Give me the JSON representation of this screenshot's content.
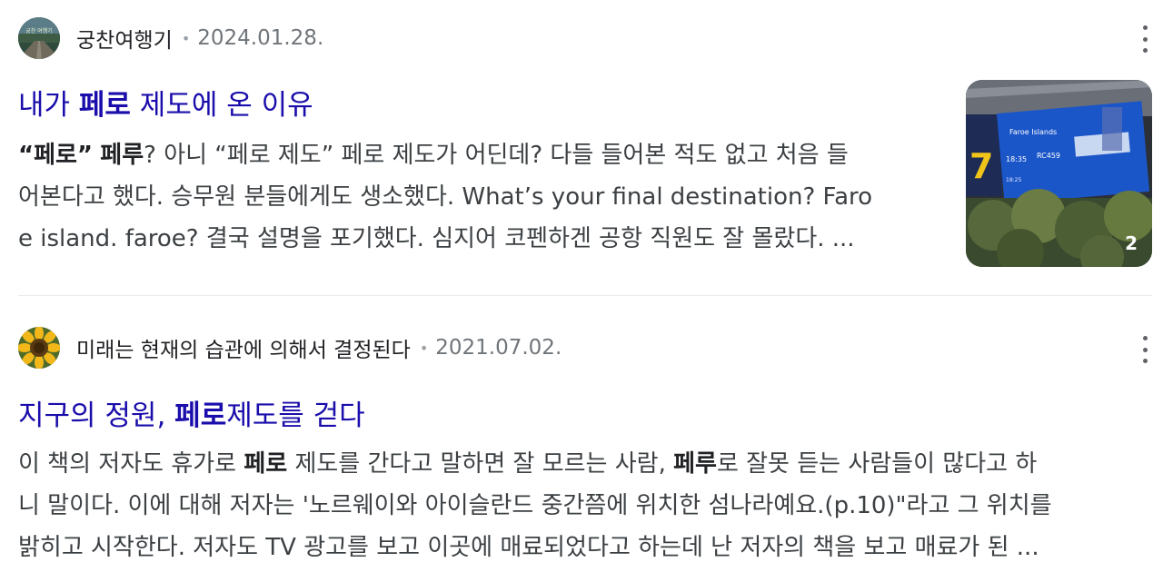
{
  "results": [
    {
      "source": "궁찬여행기",
      "separator": "•",
      "date": "2024.01.28.",
      "avatar_icon": "travel-landscape-avatar",
      "title_pre": "내가 ",
      "title_bold": "페로",
      "title_post": " 제도에 온 이유",
      "snippet": {
        "l1_b1": "“페로”",
        "l1_t1": " ",
        "l1_b2": "페루",
        "l1_t2": "? 아니 “페로 제도” 페로 제도가 어딘데? 다들 들어본 적도 없고 처음 들",
        "l2": "어본다고 했다. 승무원 분들에게도 생소했다. What’s your final destination? Faro",
        "l3": "e island. faroe? 결국 설명을 포기했다. 심지어 코펜하겐 공항 직원도 잘 몰랐다. ..."
      },
      "thumbnail": {
        "image_count": "2",
        "board_header": "Faroe Islands",
        "board_time": "18:35",
        "board_flight": "RC459",
        "board_time2": "18:25",
        "board_gate": "7"
      }
    },
    {
      "source": "미래는 현재의 습관에 의해서 결정된다",
      "separator": "•",
      "date": "2021.07.02.",
      "avatar_icon": "sunflower-avatar",
      "title_pre": "지구의 정원, ",
      "title_bold": "페로",
      "title_post": "제도를 걷다",
      "snippet": {
        "l1_t1": "이 책의 저자도 휴가로 ",
        "l1_b1": "페로",
        "l1_t2": " 제도를 간다고 말하면 잘 모르는 사람, ",
        "l1_b2": "페루",
        "l1_t3": "로 잘못 듣는 사람들이 많다고 하",
        "l2": "니 말이다. 이에 대해 저자는 '노르웨이와 아이슬란드 중간쯤에 위치한 섬나라예요.(p.10)\"라고 그 위치를",
        "l3": "밝히고 시작한다. 저자도 TV 광고를 보고 이곳에 매료되었다고 하는데 난 저자의 책을 보고 매료가 된 ..."
      }
    }
  ]
}
